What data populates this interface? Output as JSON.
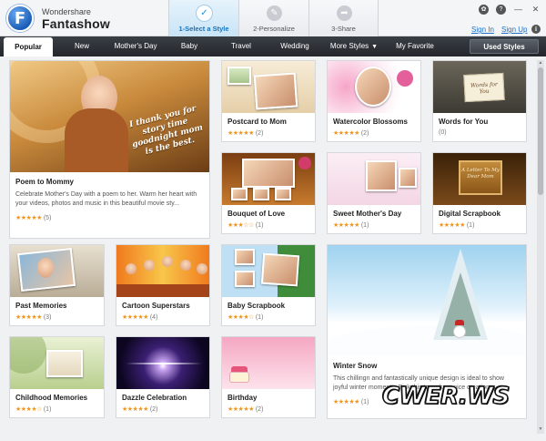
{
  "app": {
    "vendor": "Wondershare",
    "name": "Fantashow",
    "logo_letter": "F"
  },
  "steps": [
    {
      "label": "1-Select a Style",
      "icon": "check-icon",
      "glyph": "✓",
      "active": true
    },
    {
      "label": "2-Personalize",
      "icon": "pencil-icon",
      "glyph": "✎",
      "active": false
    },
    {
      "label": "3-Share",
      "icon": "share-arrow-icon",
      "glyph": "➦",
      "active": false
    }
  ],
  "window": {
    "skin_glyph": "✿",
    "help_glyph": "?",
    "min_glyph": "—",
    "close_glyph": "✕",
    "info_glyph": "i"
  },
  "account": {
    "sign_in": "Sign In",
    "sign_up": "Sign Up"
  },
  "nav": {
    "tabs": [
      "Popular",
      "New",
      "Mother's Day",
      "Baby",
      "Travel",
      "Wedding",
      "More Styles",
      "My Favorite"
    ],
    "more_caret": "▼",
    "used_styles": "Used Styles"
  },
  "cards": [
    {
      "title": "Poem to Mommy",
      "desc": "Celebrate Mother's Day with a poem to her. Warm her heart with your videos, photos and music in this beautiful movie sty...",
      "stars": "★★★★★",
      "count": "(5)",
      "overlay": "I thank you for story time goodnight mom is the best."
    },
    {
      "title": "Postcard to Mom",
      "stars": "★★★★★",
      "count": "(2)"
    },
    {
      "title": "Watercolor Blossoms",
      "stars": "★★★★★",
      "count": "(2)"
    },
    {
      "title": "Words for You",
      "stars": "",
      "count": "(0)",
      "overlay": "Words for You"
    },
    {
      "title": "Bouquet of Love",
      "stars": "★★★☆☆",
      "count": "(1)"
    },
    {
      "title": "Sweet Mother's Day",
      "stars": "★★★★★",
      "count": "(1)"
    },
    {
      "title": "Digital Scrapbook",
      "stars": "★★★★★",
      "count": "(1)",
      "overlay": "A Letter To My Dear Mom"
    },
    {
      "title": "Past Memories",
      "stars": "★★★★★",
      "count": "(3)"
    },
    {
      "title": "Cartoon Superstars",
      "stars": "★★★★★",
      "count": "(4)"
    },
    {
      "title": "Baby Scrapbook",
      "stars": "★★★★☆",
      "count": "(1)"
    },
    {
      "title": "Winter Snow",
      "desc": "This chillingn and fantastically unique design is ideal to show joyful winter moments. Pick this to make a nice creation n...",
      "stars": "★★★★★",
      "count": "(1)"
    },
    {
      "title": "Childhood Memories",
      "stars": "★★★★☆",
      "count": "(1)"
    },
    {
      "title": "Dazzle Celebration",
      "stars": "★★★★★",
      "count": "(2)"
    },
    {
      "title": "Birthday",
      "stars": "★★★★★",
      "count": "(2)"
    }
  ],
  "watermark": "CWER.WS",
  "colors": {
    "accent": "#1a8fd6",
    "nav_bg": "#2b2e33",
    "star": "#f0961e",
    "link": "#1a6fc9"
  }
}
